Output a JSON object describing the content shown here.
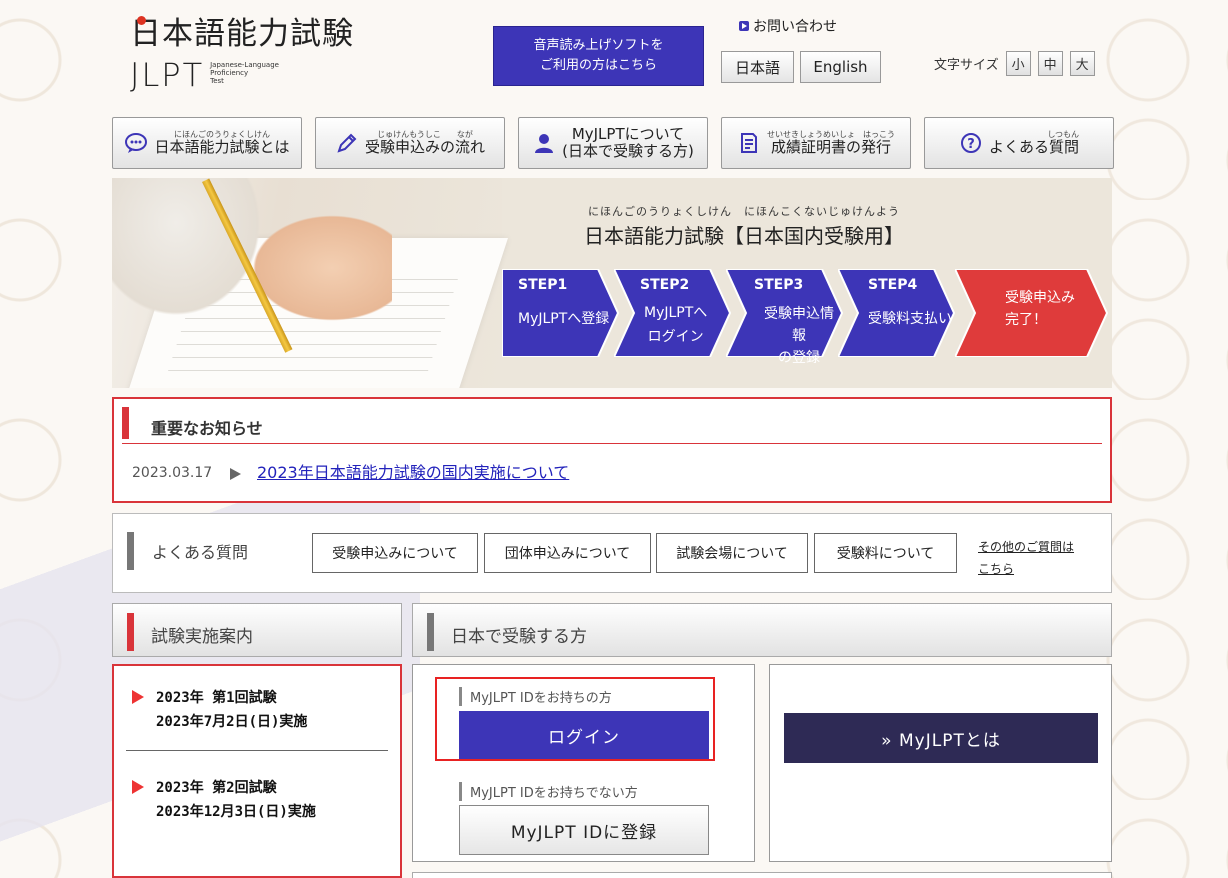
{
  "header": {
    "logo_jp": "日本語能力試験",
    "logo_en": "JLPT",
    "logo_sub": [
      "Japanese-Language",
      "Proficiency",
      "Test"
    ],
    "speech_line1": "音声読み上げソフトを",
    "speech_line2": "ご利用の方はこちら",
    "inquiry": "お問い合わせ",
    "lang_ja": "日本語",
    "lang_en": "English",
    "fontsize_label": "文字サイズ",
    "fs_small": "小",
    "fs_medium": "中",
    "fs_large": "大"
  },
  "nav": [
    {
      "ruby": "にほんごのうりょくしけん",
      "label": "日本語能力試験とは"
    },
    {
      "ruby": "じゅけんもうしこ　　なが",
      "label": "受験申込みの流れ"
    },
    {
      "label_line1": "MyJLPTについて",
      "label_line2": "(日本で受験する方)"
    },
    {
      "ruby": "せいせきしょうめいしょ　はっこう",
      "label": "成績証明書の発行"
    },
    {
      "ruby": "しつもん",
      "label": "よくある質問"
    }
  ],
  "banner": {
    "ruby": "にほんごのうりょくしけん　にほんこくないじゅけんよう",
    "title": "日本語能力試験【日本国内受験用】",
    "steps": [
      {
        "num": "STEP1",
        "text": "MyJLPTへ登録"
      },
      {
        "num": "STEP2",
        "text_line1": "MyJLPTへ",
        "text_line2": "ログイン"
      },
      {
        "num": "STEP3",
        "text_line1": "受験申込情報",
        "text_line2": "の登録"
      },
      {
        "num": "STEP4",
        "text": "受験料支払い"
      },
      {
        "text_line1": "受験申込み",
        "text_line2": "完了！"
      }
    ],
    "colors": {
      "step": "#3d35b7",
      "final": "#df3b3b"
    }
  },
  "notice": {
    "title": "重要なお知らせ",
    "date": "2023.03.17",
    "link": "2023年日本語能力試験の国内実施について"
  },
  "faq": {
    "title": "よくある質問",
    "buttons": [
      "受験申込みについて",
      "団体申込みについて",
      "試験会場について",
      "受験料について"
    ],
    "other_line1": "その他のご質問は",
    "other_line2": "こちら"
  },
  "sections": {
    "exam_info": "試験実施案内",
    "japan_exam": "日本で受験する方"
  },
  "schedule": [
    {
      "line1": "2023年 第1回試験",
      "line2": "2023年7月2日(日)実施"
    },
    {
      "line1": "2023年 第2回試験",
      "line2": "2023年12月3日(日)実施"
    }
  ],
  "login": {
    "has_id_label": "MyJLPT IDをお持ちの方",
    "login_btn": "ログイン",
    "no_id_label": "MyJLPT IDをお持ちでない方",
    "register_btn": "MyJLPT IDに登録"
  },
  "about": {
    "button": "» MyJLPTとは"
  }
}
